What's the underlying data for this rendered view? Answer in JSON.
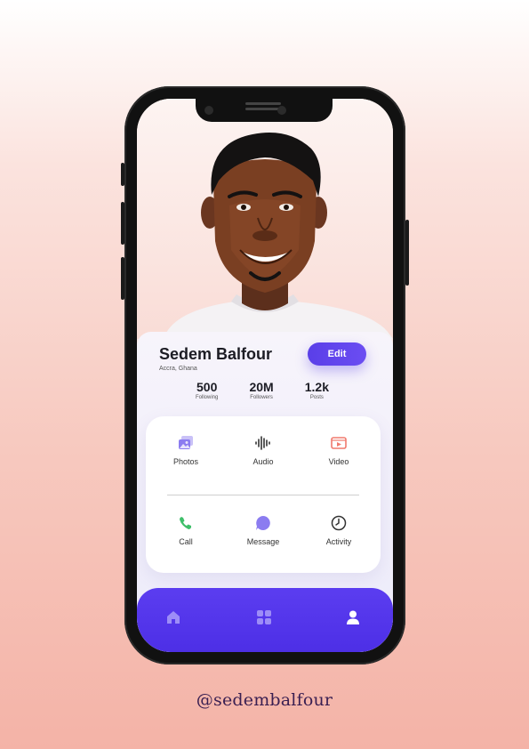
{
  "profile": {
    "name": "Sedem Balfour",
    "location": "Accra, Ghana",
    "edit_label": "Edit"
  },
  "stats": [
    {
      "value": "500",
      "label": "Following"
    },
    {
      "value": "20M",
      "label": "Followers"
    },
    {
      "value": "1.2k",
      "label": "Posts"
    }
  ],
  "actions": [
    {
      "label": "Photos",
      "icon": "photos-icon",
      "color": "#8b7cf0"
    },
    {
      "label": "Audio",
      "icon": "audio-wave-icon",
      "color": "#333333"
    },
    {
      "label": "Video",
      "icon": "video-icon",
      "color": "#f07a6e"
    },
    {
      "label": "Call",
      "icon": "phone-icon",
      "color": "#3fbf6a"
    },
    {
      "label": "Message",
      "icon": "message-icon",
      "color": "#8b7cf0"
    },
    {
      "label": "Activity",
      "icon": "clock-icon",
      "color": "#333333"
    }
  ],
  "tabbar": {
    "items": [
      {
        "icon": "home-icon",
        "active": false
      },
      {
        "icon": "grid-icon",
        "active": false
      },
      {
        "icon": "user-icon",
        "active": true
      }
    ],
    "color": "#5b3df0"
  },
  "handle": "@sedembalfour",
  "colors": {
    "accent": "#5a3fe8",
    "background_top": "#ffffff",
    "background_bottom": "#f4b3a7"
  }
}
